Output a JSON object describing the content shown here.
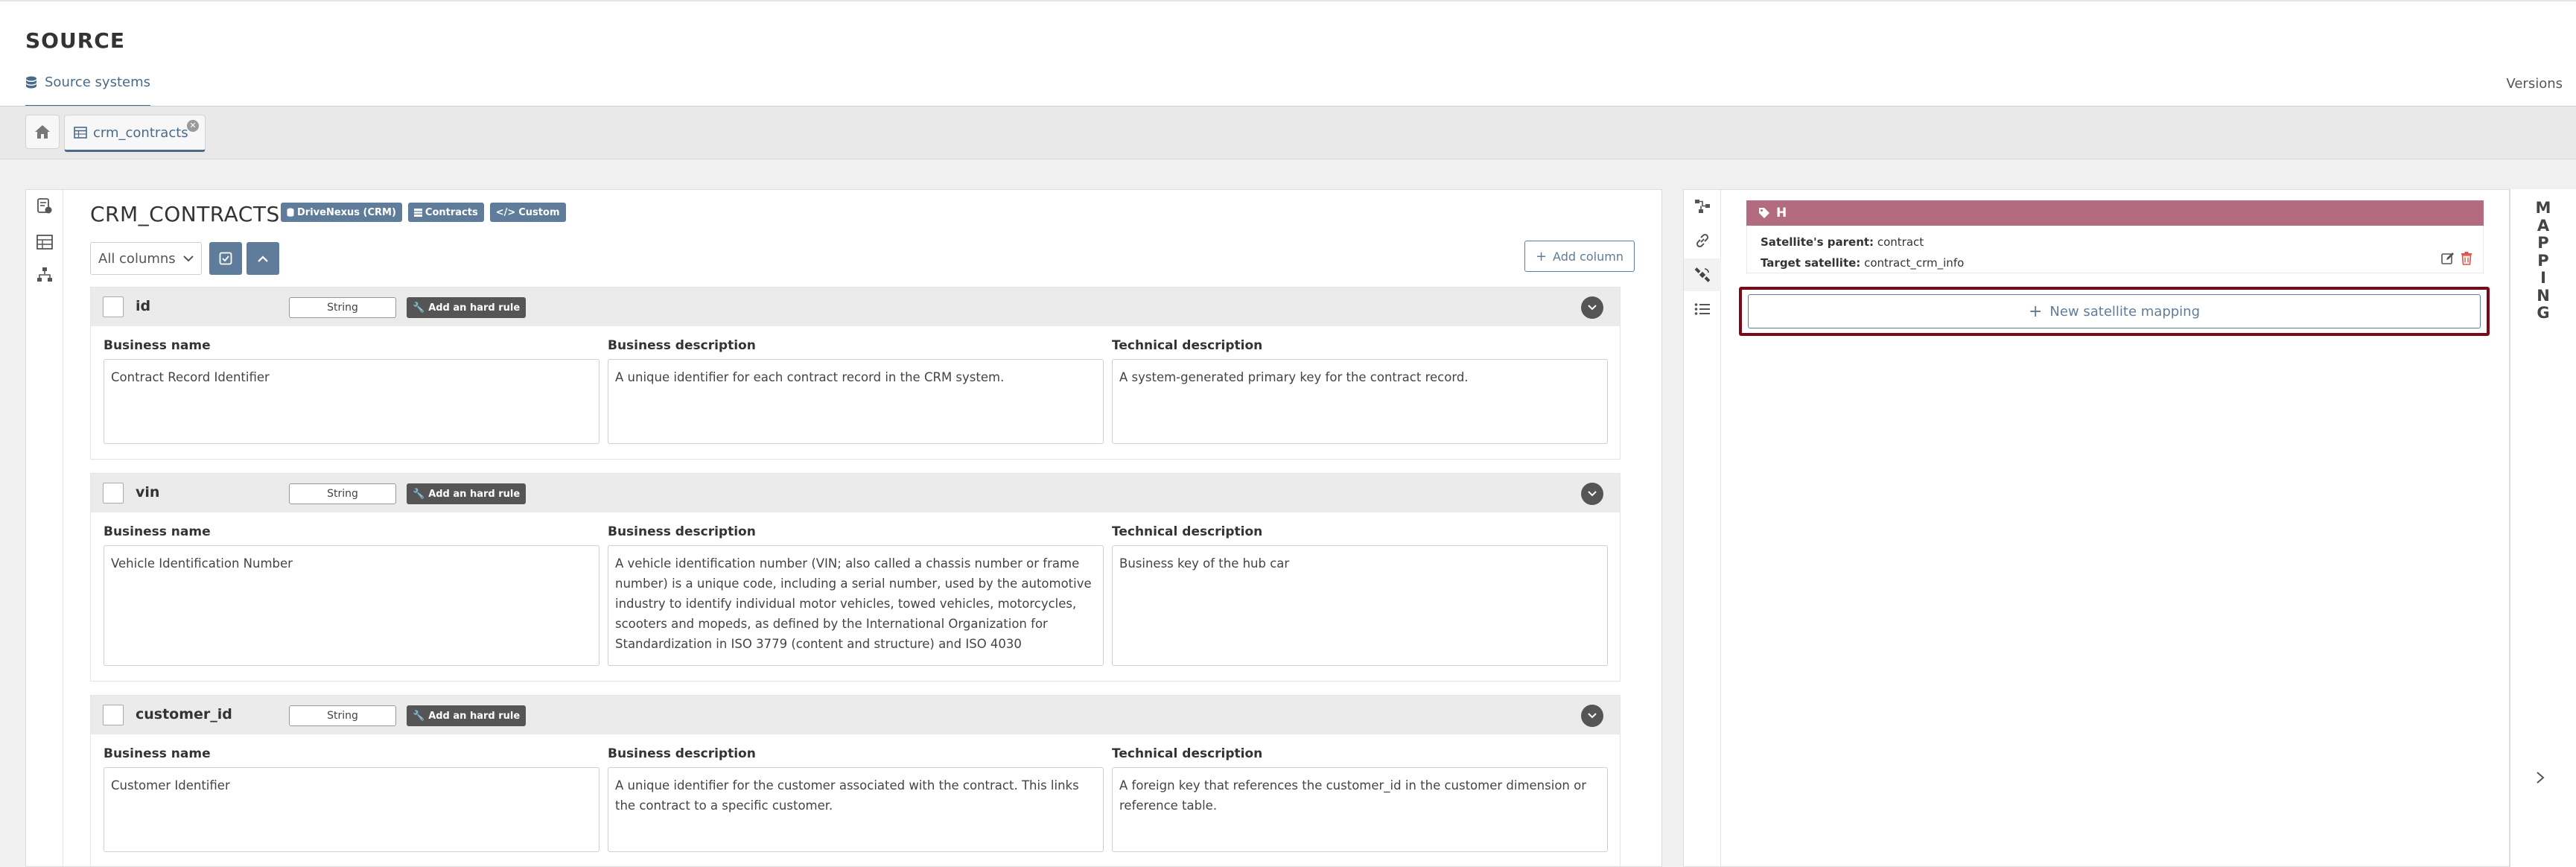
{
  "header": {
    "app_title": "SOURCE",
    "nav_tab_label": "Source systems",
    "versions_label": "Versions"
  },
  "tabs": {
    "home_icon": "home-icon",
    "open_tab_label": "crm_contracts"
  },
  "table": {
    "title": "CRM_CONTRACTS",
    "badges": [
      {
        "icon": "database-icon",
        "label": "DriveNexus (CRM)"
      },
      {
        "icon": "list-icon",
        "label": "Contracts"
      },
      {
        "icon": "code-icon",
        "label": "Custom"
      }
    ],
    "filter_value": "All columns",
    "add_column_label": "Add column",
    "field_labels": {
      "business_name": "Business name",
      "business_description": "Business description",
      "technical_description": "Technical description"
    },
    "add_rule_label": "Add an hard rule",
    "columns": [
      {
        "name": "id",
        "type": "String",
        "business_name": "Contract Record Identifier",
        "business_description": "A unique identifier for each contract record in the CRM system.",
        "technical_description": "A system-generated primary key for the contract record."
      },
      {
        "name": "vin",
        "type": "String",
        "business_name": "Vehicle Identification Number",
        "business_description": "A vehicle identification number (VIN; also called a chassis number or frame number) is a unique code, including a serial number, used by the automotive industry to identify individual motor vehicles, towed vehicles, motorcycles, scooters and mopeds, as defined by the International Organization for Standardization in ISO 3779 (content and structure) and ISO 4030",
        "technical_description": "Business key of the hub car"
      },
      {
        "name": "customer_id",
        "type": "String",
        "business_name": "Customer Identifier",
        "business_description": "A unique identifier for the customer associated with the contract. This links the contract to a specific customer.",
        "technical_description": "A foreign key that references the customer_id in the customer dimension or reference table."
      }
    ]
  },
  "mapping": {
    "satellite_header": "H",
    "parent_label": "Satellite's parent:",
    "parent_value": "contract",
    "target_label": "Target satellite:",
    "target_value": "contract_crm_info",
    "new_mapping_label": "New satellite mapping",
    "rail_letters": [
      "M",
      "A",
      "P",
      "P",
      "I",
      "N",
      "G"
    ]
  },
  "colors": {
    "accent": "#5f7d9b",
    "satellite_header": "#b36b80",
    "highlight_border": "#7a0a18",
    "delete_icon": "#d9534f"
  }
}
